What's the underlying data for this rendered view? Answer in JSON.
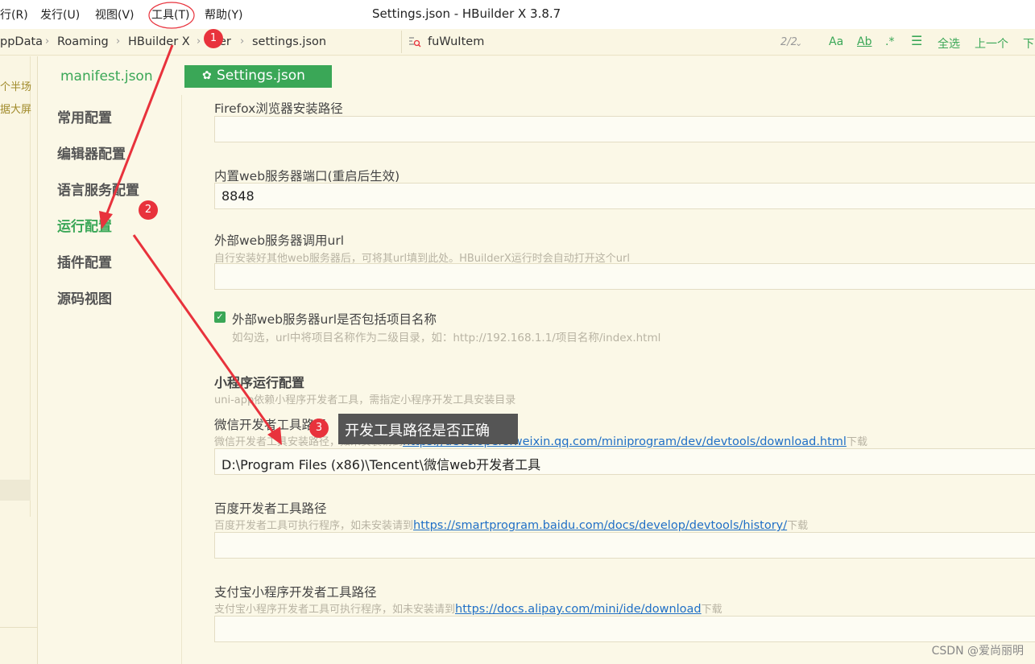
{
  "menu": {
    "items": [
      "行(R)",
      "发行(U)",
      "视图(V)",
      "工具(T)",
      "帮助(Y)"
    ],
    "window_title": "Settings.json - HBuilder X 3.8.7"
  },
  "breadcrumb": [
    "ppData",
    "Roaming",
    "HBuilder X",
    "er",
    "settings.json"
  ],
  "search": {
    "value": "fuWuItem",
    "count": "2/2",
    "btn_case": "Aa",
    "btn_word": "Ab",
    "btn_regex": ".*",
    "select_all": "全选",
    "prev": "上一个",
    "next": "下"
  },
  "left_stub": [
    "个半场",
    "据大屏"
  ],
  "tabs": {
    "manifest": "manifest.json",
    "settings": "Settings.json"
  },
  "nav": [
    "常用配置",
    "编辑器配置",
    "语言服务配置",
    "运行配置",
    "插件配置",
    "源码视图"
  ],
  "settings": {
    "firefox_label": "Firefox浏览器安装路径",
    "firefox_value": "",
    "port_label": "内置web服务器端口(重启后生效)",
    "port_value": "8848",
    "ext_url_label": "外部web服务器调用url",
    "ext_url_hint": "自行安装好其他web服务器后，可将其url填到此处。HBuilderX运行时会自动打开这个url",
    "ext_url_value": "",
    "include_name_label": "外部web服务器url是否包括项目名称",
    "include_name_checked": true,
    "include_name_hint": "如勾选，url中将项目名称作为二级目录，如：http://192.168.1.1/项目名称/index.html",
    "mp_section": "小程序运行配置",
    "mp_section_hint": "uni-app依赖小程序开发者工具，需指定小程序开发工具安装目录",
    "wx_label": "微信开发者工具路径",
    "wx_hint_pre": "微信开发者工具安装路径，如未安装请到",
    "wx_hint_link": "https://developers.weixin.qq.com/miniprogram/dev/devtools/download.html",
    "wx_hint_post": "下载",
    "wx_value": "D:\\Program Files (x86)\\Tencent\\微信web开发者工具",
    "bd_label": "百度开发者工具路径",
    "bd_hint_pre": "百度开发者工具可执行程序，如未安装请到",
    "bd_hint_link": "https://smartprogram.baidu.com/docs/develop/devtools/history/",
    "bd_hint_post": "下载",
    "bd_value": "",
    "ali_label": "支付宝小程序开发者工具路径",
    "ali_hint_pre": "支付宝小程序开发者工具可执行程序，如未安装请到",
    "ali_hint_link": "https://docs.alipay.com/mini/ide/download",
    "ali_hint_post": "下载",
    "ali_value": ""
  },
  "annotations": {
    "badge1": "1",
    "badge2": "2",
    "badge3": "3",
    "tooltip": "开发工具路径是否正确",
    "arrow_color": "#e8323c"
  },
  "watermark": "CSDN @爱尚丽明",
  "colors": {
    "accent": "#3aa757",
    "link": "#1f6fc6",
    "background": "#faf6e3"
  }
}
